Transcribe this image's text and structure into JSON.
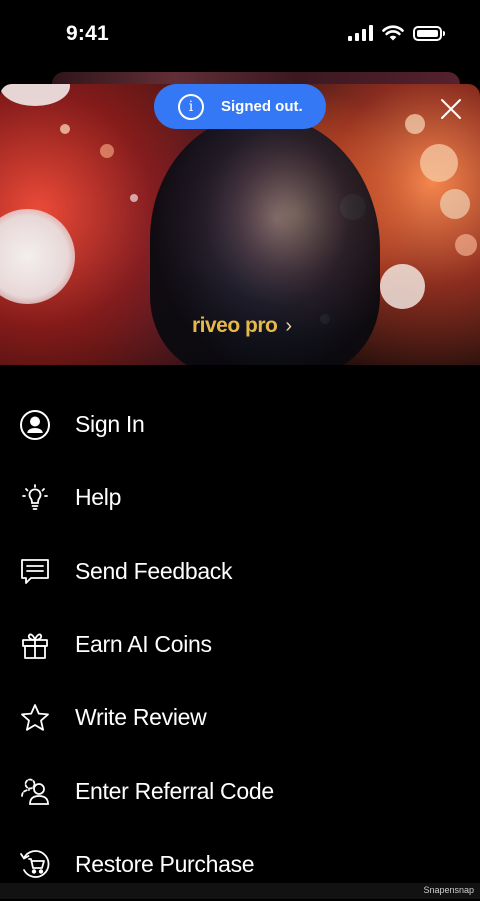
{
  "status_bar": {
    "time": "9:41"
  },
  "toast": {
    "icon": "info-icon",
    "text": "Signed out.",
    "color": "#3478f6"
  },
  "banner": {
    "brand": "riveo pro",
    "chevron": "›",
    "brand_color": "#e5b84a"
  },
  "menu": {
    "items": [
      {
        "label": "Sign In",
        "icon": "user-circle-icon"
      },
      {
        "label": "Help",
        "icon": "lightbulb-icon"
      },
      {
        "label": "Send Feedback",
        "icon": "message-icon"
      },
      {
        "label": "Earn AI Coins",
        "icon": "gift-icon"
      },
      {
        "label": "Write Review",
        "icon": "star-icon"
      },
      {
        "label": "Enter Referral Code",
        "icon": "users-icon"
      },
      {
        "label": "Restore Purchase",
        "icon": "cart-restore-icon"
      }
    ]
  },
  "watermark": "Snapensnap"
}
